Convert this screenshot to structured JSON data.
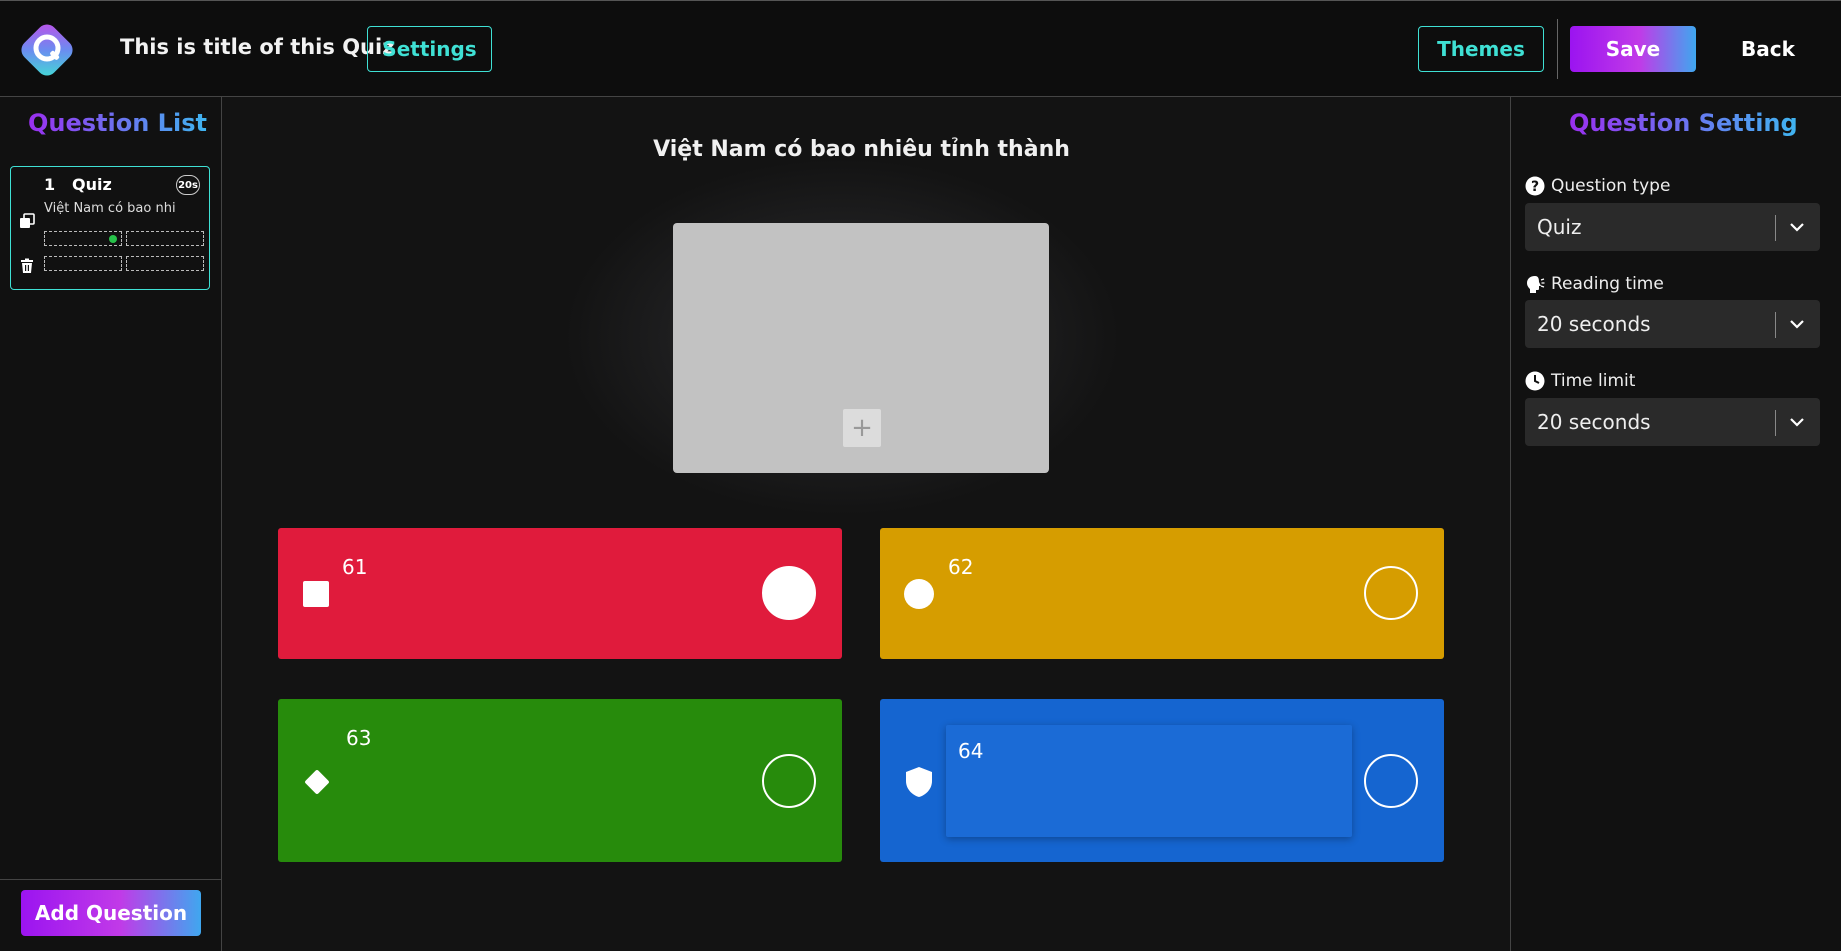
{
  "header": {
    "title": "This is title of this Quiz",
    "settings_label": "Settings",
    "themes_label": "Themes",
    "save_label": "Save",
    "back_label": "Back",
    "logo_icon": "quiz-logo-icon"
  },
  "left_panel": {
    "title": "Question List",
    "questions": [
      {
        "number": "1",
        "type": "Quiz",
        "time": "20s",
        "text": "Việt Nam có bao nhi"
      }
    ],
    "add_button_label": "Add Question"
  },
  "main": {
    "question_text": "Việt Nam có bao nhiêu tỉnh thành",
    "media_add_icon": "+",
    "answers": [
      {
        "label": "61",
        "color": "#e01b3c",
        "shape": "square-icon",
        "correct": true
      },
      {
        "label": "62",
        "color": "#d69d00",
        "shape": "circle-icon",
        "correct": false
      },
      {
        "label": "63",
        "color": "#278b0c",
        "shape": "diamond-icon",
        "correct": false
      },
      {
        "label": "64",
        "color": "#1565d0",
        "shape": "shield-icon",
        "correct": false
      }
    ]
  },
  "right_panel": {
    "title": "Question Setting",
    "question_type": {
      "label": "Question type",
      "value": "Quiz"
    },
    "reading_time": {
      "label": "Reading time",
      "value": "20 seconds"
    },
    "time_limit": {
      "label": "Time limit",
      "value": "20 seconds"
    }
  }
}
